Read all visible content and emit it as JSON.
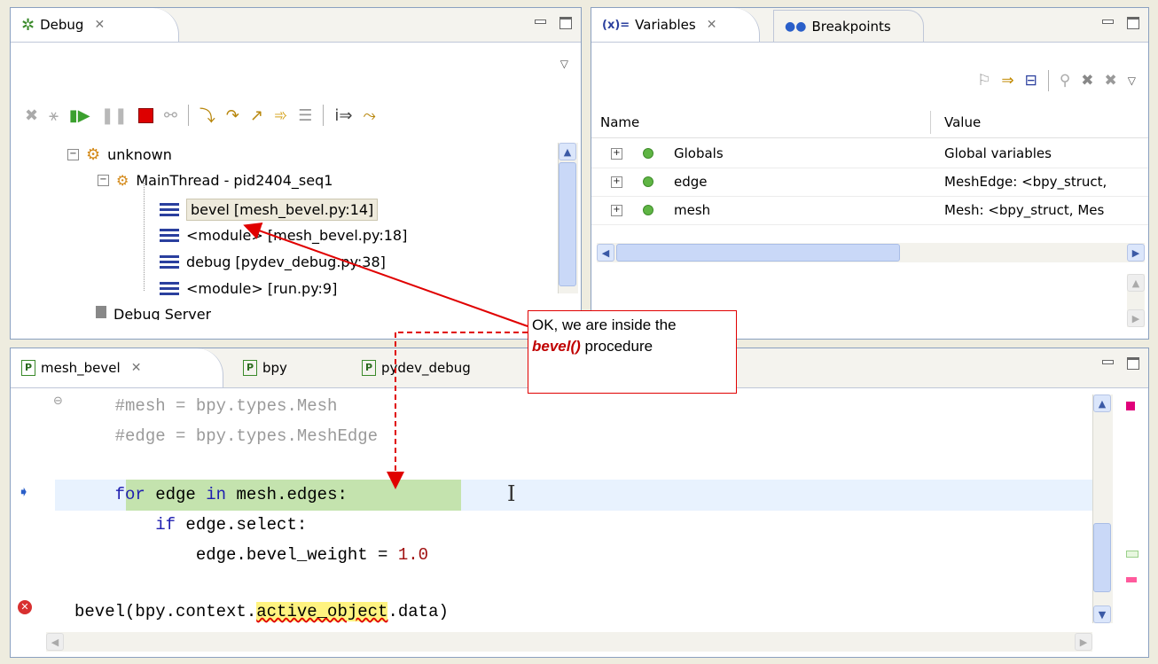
{
  "debug_view": {
    "tab_label": "Debug",
    "toolbar_icons": [
      "remove-terminated-icon",
      "disconnect-icon",
      "resume-icon",
      "suspend-icon",
      "terminate-icon",
      "disconnect-all-icon",
      "step-into-icon",
      "step-over-icon",
      "step-return-icon",
      "drop-to-frame-icon",
      "use-step-filters-icon",
      "instruction-step-icon",
      "step-filters-icon"
    ],
    "tree": [
      {
        "label": "unknown",
        "kind": "process"
      },
      {
        "label": "MainThread - pid2404_seq1",
        "kind": "thread"
      },
      {
        "label": "bevel [mesh_bevel.py:14]",
        "kind": "frame",
        "selected": true
      },
      {
        "label": "<module> [mesh_bevel.py:18]",
        "kind": "frame"
      },
      {
        "label": "debug [pydev_debug.py:38]",
        "kind": "frame"
      },
      {
        "label": "<module> [run.py:9]",
        "kind": "frame"
      },
      {
        "label": "Debug Server",
        "kind": "server"
      }
    ]
  },
  "variables_view": {
    "tab_variables": "Variables",
    "tab_variables_prefix": "(x)=",
    "tab_breakpoints": "Breakpoints",
    "col_name": "Name",
    "col_value": "Value",
    "rows": [
      {
        "name": "Globals",
        "value": "Global variables"
      },
      {
        "name": "edge",
        "value": "MeshEdge: <bpy_struct,"
      },
      {
        "name": "mesh",
        "value": "Mesh: <bpy_struct, Mes"
      }
    ]
  },
  "editor": {
    "tabs": [
      "mesh_bevel",
      "bpy",
      "pydev_debug"
    ],
    "lines": {
      "l1": "    #mesh = bpy.types.Mesh",
      "l2": "    #edge = bpy.types.MeshEdge",
      "l4_indent": "    ",
      "l4_kw1": "for",
      "l4_mid": " edge ",
      "l4_kw2": "in",
      "l4_end": " mesh.edges:",
      "l5_indent": "        ",
      "l5_kw": "if",
      "l5_end": " edge.select:",
      "l6_text": "            edge.bevel_weight = ",
      "l6_num": "1.0",
      "l8_pre": "bevel(bpy.context.",
      "l8_hl": "active_object",
      "l8_post": ".data)"
    }
  },
  "callout": {
    "line1": "OK, we are inside the",
    "emph": "bevel()",
    "line2_rest": " procedure"
  },
  "colors": {
    "accent_red": "#e00000",
    "current_line": "#c4e3ae",
    "highlight_line": "#e8f2fe",
    "keyword": "#1f1fb0"
  }
}
